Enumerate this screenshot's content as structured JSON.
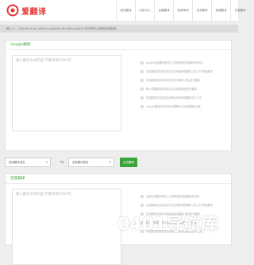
{
  "header": {
    "logo_text": "爱翻译",
    "nav": [
      "现在翻译",
      "问答中心",
      "百度翻译",
      "英语单词",
      "文本翻译",
      "英语翻译",
      "日语翻译"
    ]
  },
  "notice": {
    "text": "输入 lc ：Genres is an infinite capacity for taking pains.天才即无止境地刻苦勤奋。"
  },
  "google": {
    "title": "Google翻译",
    "placeholder": "输入翻译文本内容,字数限制5000字。",
    "tips": [
      "google在线翻译提供上方框框粘贴或者翻译的内容",
      "在线翻译支持英文和中文互相转换的翻译工具,对于其他翻译",
      "在线翻译支持单词和手机文件翻译,然后进行翻译",
      "输入需要翻译的内容并点击翻译按钮进行翻译",
      "在线翻译支持在线全部的功能和段落翻译文字工具",
      "Google翻译在线支持日语翻译以及英语翻译功能"
    ]
  },
  "controls": {
    "from_label": "选择翻译语言",
    "to_label": "选择翻译语言",
    "swap_icon": "⇆",
    "button_label": "点击翻译"
  },
  "baidu": {
    "title": "百度翻译",
    "placeholder": "输入翻译文本内容,字数限制5000字。",
    "tips": [
      "百度在线翻译提供上方框框粘贴或者翻译的内容",
      "在线翻译支持英文和中文互相转换的翻译工具,对于其他翻译",
      "在线翻译支持单词和手机文件翻译,然后进行翻译",
      "输入需要翻译的内容并点击翻译按钮进行翻译",
      "在线翻译支持在线全部的功能和段落翻译文字工具"
    ]
  },
  "watermark": "0401导航库",
  "colors": {
    "brand": "#e43434",
    "accent": "#3aa33a"
  }
}
